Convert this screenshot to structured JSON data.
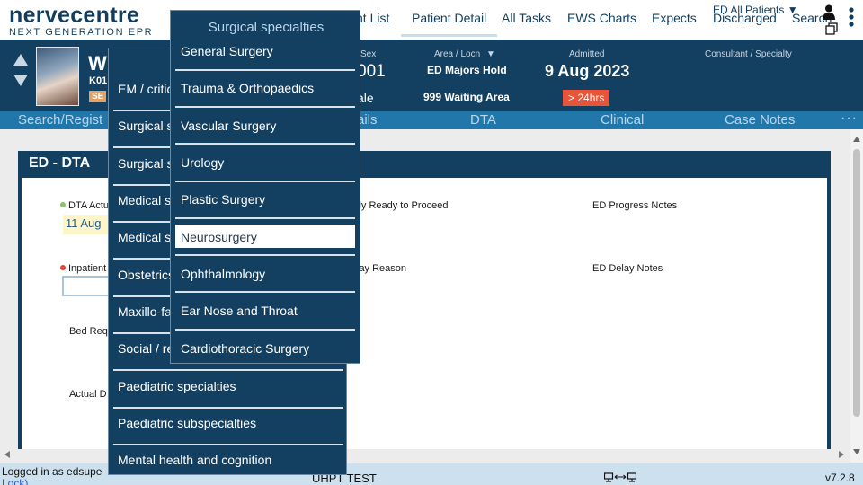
{
  "app": {
    "logo_main": "nervecentre",
    "logo_sub": "NEXT GENERATION EPR"
  },
  "nav": {
    "tabs": [
      {
        "label": "nt List"
      },
      {
        "label": "Patient Detail"
      },
      {
        "label": "All Tasks"
      },
      {
        "label": "EWS Charts"
      },
      {
        "label": "Expects"
      },
      {
        "label": "Discharged"
      },
      {
        "label": "Search"
      }
    ],
    "filter_label": "ED All Patients",
    "filter_arrow": "▼"
  },
  "patient": {
    "name": "W",
    "id": "K01",
    "tag": "SE",
    "sex_label": "Sex",
    "dob": "001",
    "gender": "ale",
    "area_label": "Area / Locn",
    "area_arrow": "▼",
    "area": "ED Majors Hold",
    "location": "999 Waiting Area",
    "admitted_label": "Admitted",
    "admitted": "9 Aug 2023",
    "badge": "> 24hrs",
    "consultant_label": "Consultant / Specialty"
  },
  "subtabs": [
    {
      "label": "Search/Regist"
    },
    {
      "label": "ails"
    },
    {
      "label": "DTA"
    },
    {
      "label": "Clinical"
    },
    {
      "label": "Case Notes"
    }
  ],
  "more": "···",
  "form": {
    "title": "ED - DTA",
    "dta_label": "DTA Actu",
    "dta_value": "11 Aug",
    "ready_label": "lly Ready to Proceed",
    "progress_label": "ED Progress Notes",
    "inpatient_label": "Inpatient",
    "delay_reason_label": "lay Reason",
    "delay_notes_label": "ED Delay Notes",
    "bed_label": "Bed Req",
    "actual_label": "Actual D"
  },
  "menu_left": {
    "items": [
      {
        "label": "EM / critic"
      },
      {
        "label": "Surgical s"
      },
      {
        "label": "Surgical s"
      },
      {
        "label": "Medical s"
      },
      {
        "label": "Medical s"
      },
      {
        "label": "Obstetrics"
      },
      {
        "label": "Maxillo-fa"
      },
      {
        "label": "Social / re"
      },
      {
        "label": "Paediatric specialties"
      },
      {
        "label": "Paediatric subspecialties"
      },
      {
        "label": "Mental health and cognition"
      }
    ]
  },
  "menu_right": {
    "header": "Surgical specialties",
    "items": [
      {
        "label": "General Surgery"
      },
      {
        "label": "Trauma & Orthopaedics"
      },
      {
        "label": "Vascular Surgery"
      },
      {
        "label": "Urology"
      },
      {
        "label": "Plastic Surgery"
      },
      {
        "label": "Neurosurgery"
      },
      {
        "label": "Ophthalmology"
      },
      {
        "label": "Ear Nose and Throat"
      },
      {
        "label": "Cardiothoracic Surgery"
      }
    ],
    "selected": "Neurosurgery"
  },
  "status": {
    "login": "Logged in as edsupe",
    "lock": "Lock)",
    "env": "UHPT TEST",
    "screens_icon": "monitor-switch-icon",
    "version": "v7.2.8"
  },
  "colors": {
    "navy": "#134060",
    "subtab_blue": "#2277aa",
    "badge_red": "#e8543a",
    "status_bg": "#cde0ee"
  }
}
